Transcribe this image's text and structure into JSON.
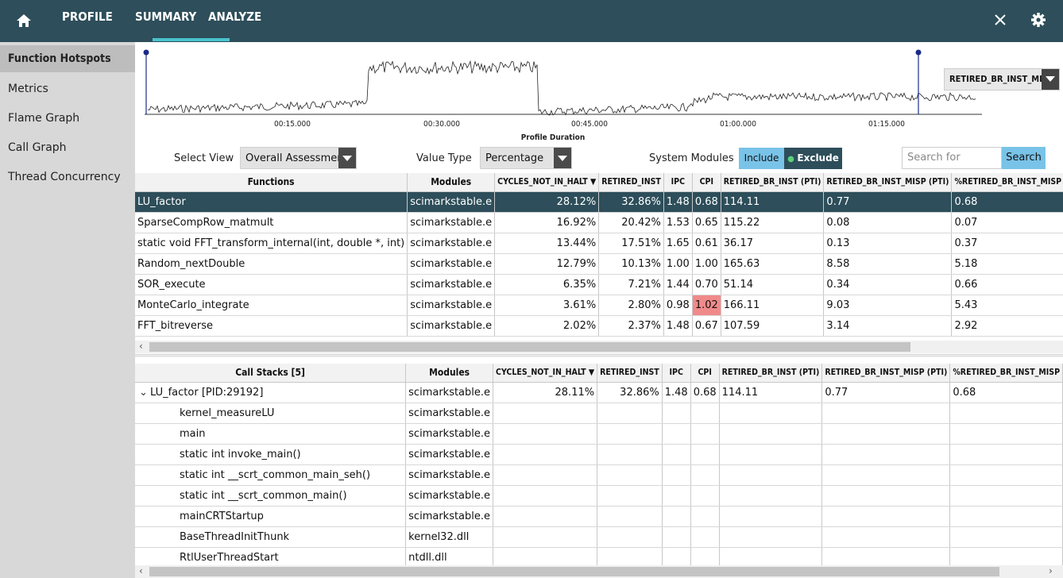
{
  "tabs": {
    "profile": "PROFILE",
    "summary": "SUMMARY",
    "analyze": "ANALYZE"
  },
  "sidebar": {
    "items": [
      {
        "label": "Function Hotspots",
        "active": true
      },
      {
        "label": "Metrics"
      },
      {
        "label": "Flame Graph"
      },
      {
        "label": "Call Graph"
      },
      {
        "label": "Thread Concurrency"
      }
    ]
  },
  "timeline": {
    "ticks": [
      "00:15.000",
      "00:30.000",
      "00:45.000",
      "01:00.000",
      "01:15.000"
    ],
    "axis_title": "Profile Duration",
    "metric_selected": "RETIRED_BR_INST_MISP"
  },
  "controls": {
    "select_view_label": "Select View",
    "select_view_value": "Overall Assessment",
    "value_type_label": "Value Type",
    "value_type_value": "Percentage",
    "system_modules_label": "System Modules",
    "include_label": "Include",
    "exclude_label": "Exclude",
    "search_placeholder": "Search for functio...",
    "search_button": "Search"
  },
  "functions_table": {
    "headers": [
      "Functions",
      "Modules",
      "CYCLES_NOT_IN_HALT ▼",
      "RETIRED_INST",
      "IPC",
      "CPI",
      "RETIRED_BR_INST (PTI)",
      "RETIRED_BR_INST_MISP (PTI)",
      "%RETIRED_BR_INST_MISP"
    ],
    "rows": [
      [
        "LU_factor",
        "scimarkstable.e",
        "28.12%",
        "32.86%",
        "1.48",
        "0.68",
        "114.11",
        "0.77",
        "0.68"
      ],
      [
        "SparseCompRow_matmult",
        "scimarkstable.e",
        "16.92%",
        "20.42%",
        "1.53",
        "0.65",
        "115.22",
        "0.08",
        "0.07"
      ],
      [
        "static void FFT_transform_internal(int, double *, int)",
        "scimarkstable.e",
        "13.44%",
        "17.51%",
        "1.65",
        "0.61",
        "36.17",
        "0.13",
        "0.37"
      ],
      [
        "Random_nextDouble",
        "scimarkstable.e",
        "12.79%",
        "10.13%",
        "1.00",
        "1.00",
        "165.63",
        "8.58",
        "5.18"
      ],
      [
        "SOR_execute",
        "scimarkstable.e",
        "6.35%",
        "7.21%",
        "1.44",
        "0.70",
        "51.14",
        "0.34",
        "0.66"
      ],
      [
        "MonteCarlo_integrate",
        "scimarkstable.e",
        "3.61%",
        "2.80%",
        "0.98",
        "1.02",
        "166.11",
        "9.03",
        "5.43"
      ],
      [
        "FFT_bitreverse",
        "scimarkstable.e",
        "2.02%",
        "2.37%",
        "1.48",
        "0.67",
        "107.59",
        "3.14",
        "2.92"
      ]
    ]
  },
  "callstacks_table": {
    "headers": [
      "Call Stacks [5]",
      "Modules",
      "CYCLES_NOT_IN_HALT ▼",
      "RETIRED_INST",
      "IPC",
      "CPI",
      "RETIRED_BR_INST (PTI)",
      "RETIRED_BR_INST_MISP (PTI)",
      "%RETIRED_BR_INST_MISP"
    ],
    "rows": [
      [
        "LU_factor [PID:29192]",
        "scimarkstable.e",
        "28.11%",
        "32.86%",
        "1.48",
        "0.68",
        "114.11",
        "0.77",
        "0.68"
      ],
      [
        "kernel_measureLU",
        "scimarkstable.e",
        "",
        "",
        "",
        "",
        "",
        "",
        ""
      ],
      [
        "main",
        "scimarkstable.e",
        "",
        "",
        "",
        "",
        "",
        "",
        ""
      ],
      [
        "static int invoke_main()",
        "scimarkstable.e",
        "",
        "",
        "",
        "",
        "",
        "",
        ""
      ],
      [
        "static int __scrt_common_main_seh()",
        "scimarkstable.e",
        "",
        "",
        "",
        "",
        "",
        "",
        ""
      ],
      [
        "static int __scrt_common_main()",
        "scimarkstable.e",
        "",
        "",
        "",
        "",
        "",
        "",
        ""
      ],
      [
        "mainCRTStartup",
        "scimarkstable.e",
        "",
        "",
        "",
        "",
        "",
        "",
        ""
      ],
      [
        "BaseThreadInitThunk",
        "kernel32.dll",
        "",
        "",
        "",
        "",
        "",
        "",
        ""
      ],
      [
        "RtlUserThreadStart",
        "ntdll.dll",
        "",
        "",
        "",
        "",
        "",
        "",
        ""
      ]
    ]
  },
  "colors": {
    "topbar": "#2d4e5a",
    "accent": "#4bc3cf",
    "selected_row": "#2d4e5a",
    "hot_cell": "#f08a8a",
    "include_toggle": "#79c3e8",
    "exclude_toggle": "#2d4e5a"
  }
}
